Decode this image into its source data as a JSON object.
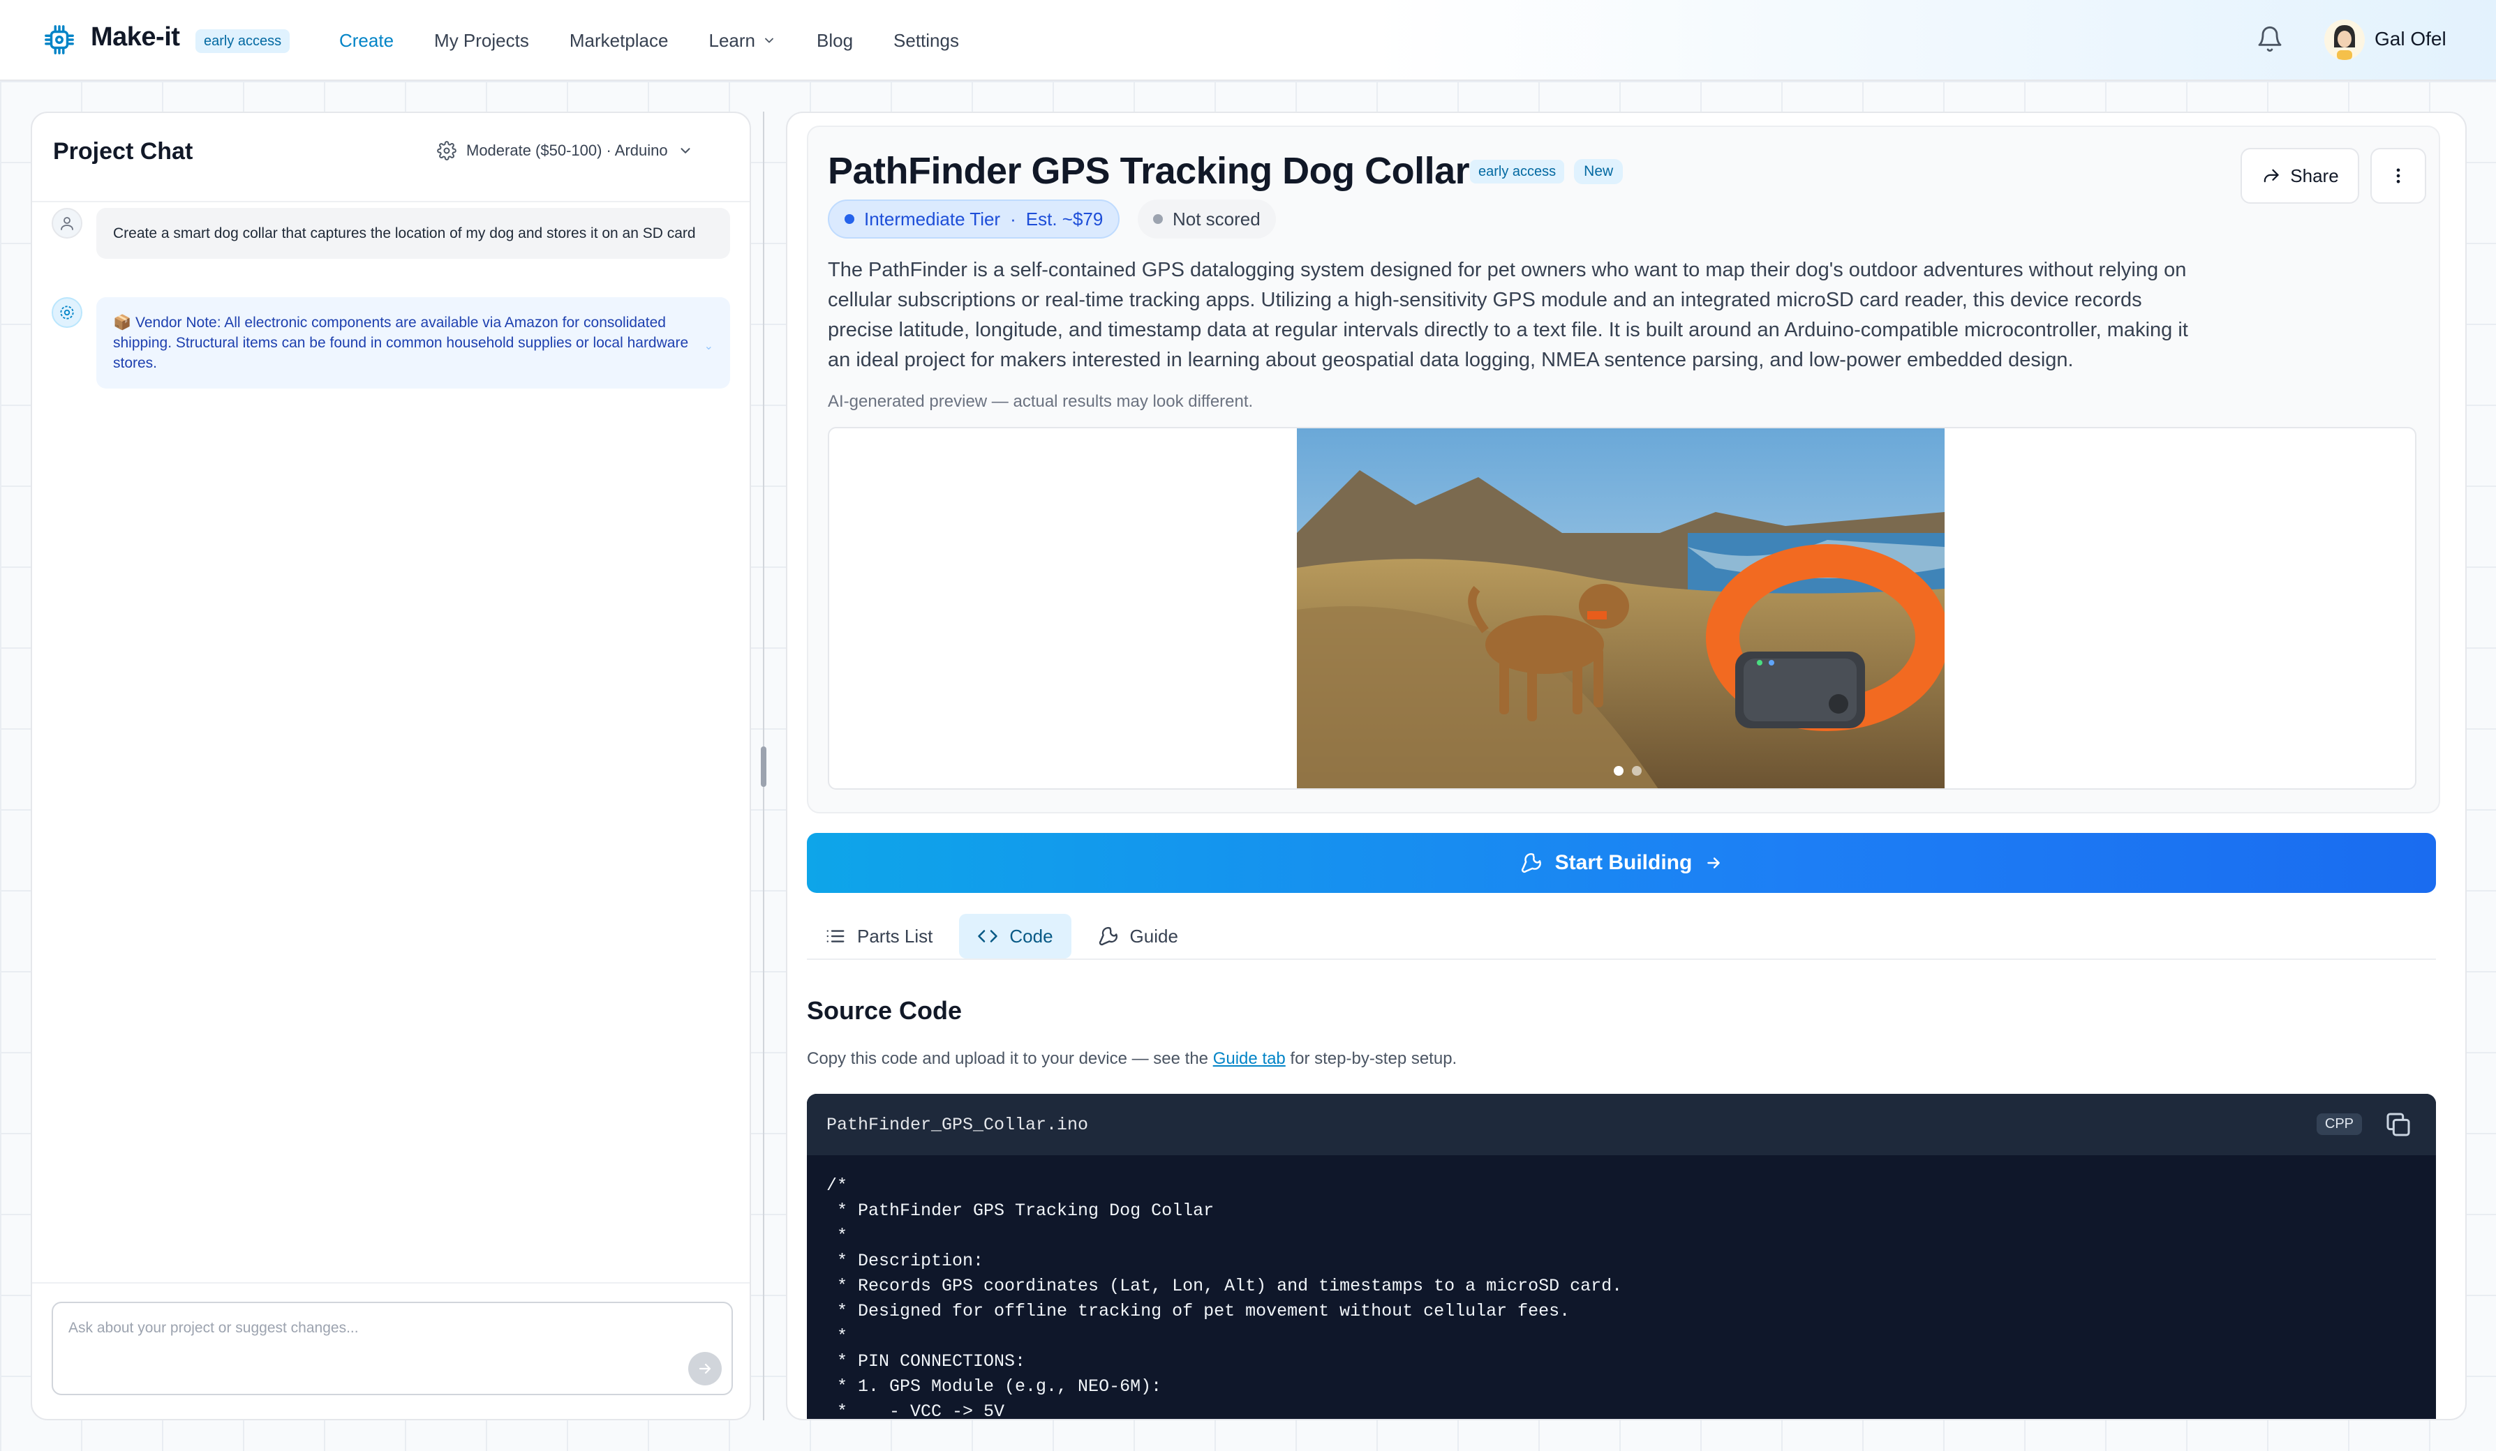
{
  "app": {
    "brand": "Make-it",
    "brand_badge": "early access",
    "nav": [
      {
        "label": "Create",
        "active": true
      },
      {
        "label": "My Projects"
      },
      {
        "label": "Marketplace"
      },
      {
        "label": "Learn"
      },
      {
        "label": "Blog"
      },
      {
        "label": "Settings"
      }
    ],
    "user_name": "Gal Ofel",
    "accent_color": "#0284c7"
  },
  "chat": {
    "title": "Project Chat",
    "filter_label": "Moderate ($50-100) · Arduino",
    "messages": [
      {
        "role": "user",
        "text": "Create a smart dog collar that captures the location of my dog and stores it on an SD card"
      },
      {
        "role": "assistant",
        "text": "📦 Vendor Note: All electronic components are available via Amazon for consolidated shipping. Structural items can be found in common household supplies or local hardware stores."
      }
    ],
    "input_placeholder": "Ask about your project or suggest changes...",
    "input_value": ""
  },
  "project": {
    "title": "PathFinder GPS Tracking Dog Collar",
    "badge_early": "early access",
    "badge_new": "New",
    "share_label": "Share",
    "tier_label": "Intermediate Tier",
    "tier_separator": "·",
    "tier_cost": "Est. ~$79",
    "score_label": "Not scored",
    "description": "The PathFinder is a self-contained GPS datalogging system designed for pet owners who want to map their dog's outdoor adventures without relying on cellular subscriptions or real-time tracking apps. Utilizing a high-sensitivity GPS module and an integrated microSD card reader, this device records precise latitude, longitude, and timestamp data at regular intervals directly to a text file. It is built around an Arduino-compatible microcontroller, making it an ideal project for makers interested in learning about geospatial data logging, NMEA sentence parsing, and low-power embedded design.",
    "ai_note": "AI-generated preview — actual results may look different.",
    "carousel_total": 2,
    "carousel_active": 1
  },
  "actions": {
    "start_building": "Start Building"
  },
  "tabs": [
    {
      "label": "Parts List",
      "icon": "list-icon"
    },
    {
      "label": "Code",
      "icon": "code-icon",
      "active": true
    },
    {
      "label": "Guide",
      "icon": "wrench-icon"
    }
  ],
  "code_section": {
    "title": "Source Code",
    "subtitle_before": "Copy this code and upload it to your device — see the ",
    "subtitle_link": "Guide tab",
    "subtitle_after": " for step-by-step setup.",
    "filename": "PathFinder_GPS_Collar.ino",
    "language": "CPP",
    "lines": [
      "/*",
      " * PathFinder GPS Tracking Dog Collar",
      " *",
      " * Description:",
      " * Records GPS coordinates (Lat, Lon, Alt) and timestamps to a microSD card.",
      " * Designed for offline tracking of pet movement without cellular fees.",
      " *",
      " * PIN CONNECTIONS:",
      " * 1. GPS Module (e.g., NEO-6M):",
      " *    - VCC -> 5V"
    ]
  }
}
